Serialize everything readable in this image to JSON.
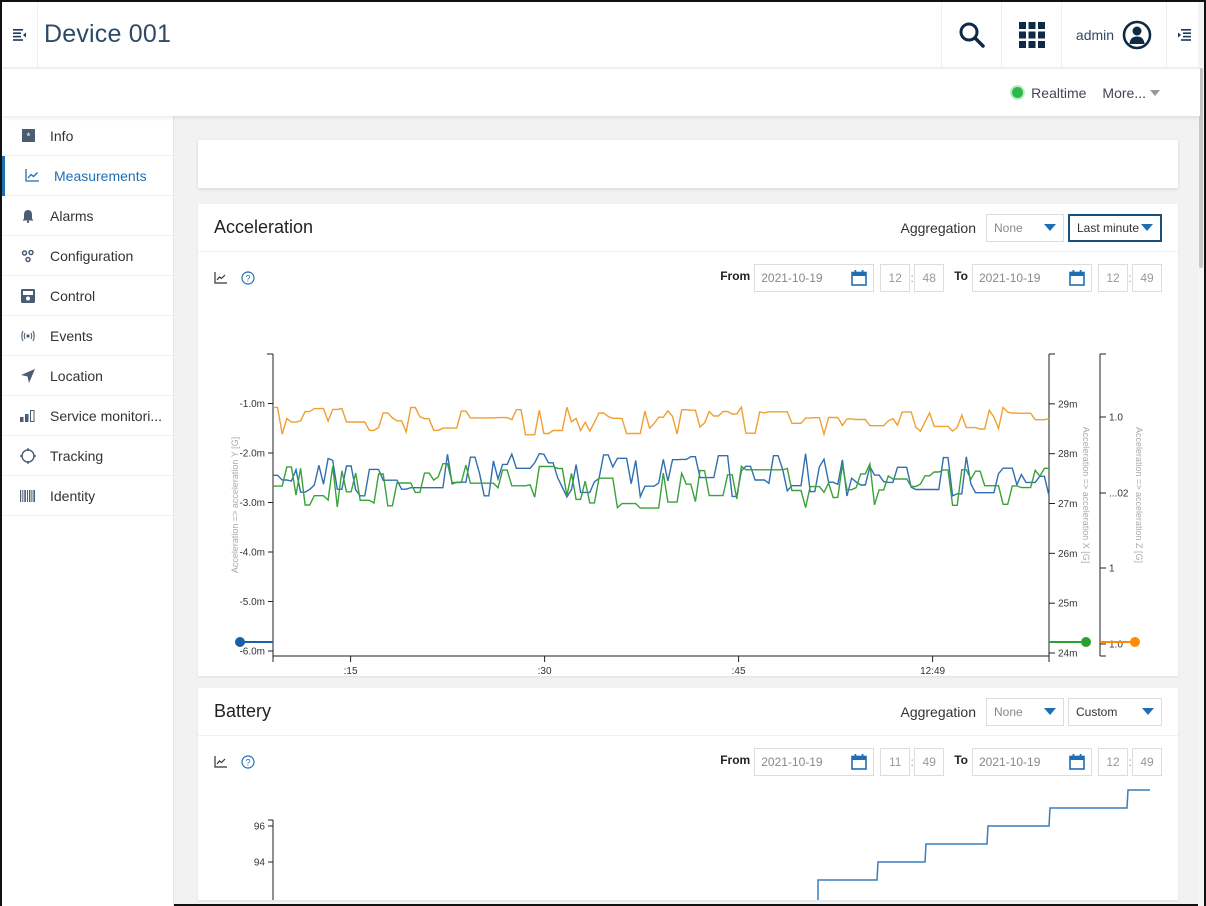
{
  "header": {
    "title": "Device 001",
    "user": "admin",
    "icons": {
      "menu_toggle": "menu-collapse-icon",
      "search": "search-icon",
      "apps": "apps-grid-icon",
      "user": "user-circle-icon",
      "right_toggle": "right-drawer-icon"
    }
  },
  "actionbar": {
    "realtime_label": "Realtime",
    "realtime_color": "#2cb94a",
    "more_label": "More..."
  },
  "sidebar": {
    "items": [
      {
        "label": "Info",
        "icon": "info-icon",
        "active": false
      },
      {
        "label": "Measurements",
        "icon": "chart-line-icon",
        "active": true
      },
      {
        "label": "Alarms",
        "icon": "bell-icon",
        "active": false
      },
      {
        "label": "Configuration",
        "icon": "gears-icon",
        "active": false
      },
      {
        "label": "Control",
        "icon": "control-icon",
        "active": false
      },
      {
        "label": "Events",
        "icon": "broadcast-icon",
        "active": false
      },
      {
        "label": "Location",
        "icon": "location-arrow-icon",
        "active": false
      },
      {
        "label": "Service monitori...",
        "icon": "signal-bars-icon",
        "active": false
      },
      {
        "label": "Tracking",
        "icon": "crosshair-icon",
        "active": false
      },
      {
        "label": "Identity",
        "icon": "barcode-icon",
        "active": false
      }
    ]
  },
  "accent_color": "#1f6eb4",
  "cards": {
    "acceleration": {
      "title": "Acceleration",
      "aggregation_label": "Aggregation",
      "aggregation_value": "None",
      "range_value": "Last minute",
      "from_label": "From",
      "from_date": "2021-10-19",
      "from_hour": "12",
      "from_minute": "48",
      "to_label": "To",
      "to_date": "2021-10-19",
      "to_hour": "12",
      "to_minute": "49"
    },
    "battery": {
      "title": "Battery",
      "aggregation_label": "Aggregation",
      "aggregation_value": "None",
      "range_value": "Custom",
      "from_label": "From",
      "from_date": "2021-10-19",
      "from_hour": "11",
      "from_minute": "49",
      "to_label": "To",
      "to_date": "2021-10-19",
      "to_hour": "12",
      "to_minute": "49"
    }
  },
  "chart_data": [
    {
      "type": "line",
      "title": "Acceleration",
      "x_ticks": [
        ":15",
        ":30",
        ":45",
        "12:49"
      ],
      "x_range_seconds": [
        9,
        69
      ],
      "x_tick_seconds": [
        15,
        30,
        45,
        60
      ],
      "axes": {
        "left": {
          "label": "Acceleration => acceleration Y [G]",
          "ticks": [
            "-1.0m",
            "-2.0m",
            "-3.0m",
            "-4.0m",
            "-5.0m",
            "-6.0m"
          ],
          "range": [
            -6.0,
            0.0
          ],
          "unit": "mG"
        },
        "right1": {
          "label": "Acceleration => acceleration X [G]",
          "ticks": [
            "29m",
            "28m",
            "27m",
            "26m",
            "25m",
            "24m"
          ],
          "range": [
            24.0,
            30.0
          ],
          "unit": "mG"
        },
        "right2": {
          "label": "Acceleration => acceleration Z [G]",
          "ticks": [
            "1.0",
            "...02",
            "1",
            "1.0"
          ]
        }
      },
      "series": [
        {
          "name": "acceleration Y",
          "axis": "left",
          "color": "#2f6fb0",
          "approx_range": [
            -3.1,
            -1.9
          ],
          "mean": -2.45
        },
        {
          "name": "acceleration X",
          "axis": "right1",
          "color": "#3aa13a",
          "approx_range": [
            26.9,
            27.9
          ],
          "mean": 27.35
        },
        {
          "name": "acceleration Z",
          "axis": "right2",
          "color": "#f0a030",
          "approx_range": "upper band",
          "mean": "~1.0"
        }
      ],
      "markers": [
        {
          "series": "acceleration Y",
          "color": "#1a5fa8"
        },
        {
          "series": "acceleration X",
          "color": "#2ca02c"
        },
        {
          "series": "acceleration Z",
          "color": "#ff8c00"
        }
      ]
    },
    {
      "type": "line",
      "title": "Battery",
      "y_ticks": [
        "96",
        "94"
      ],
      "y_range_visible": [
        92,
        98
      ],
      "series": [
        {
          "name": "battery",
          "color": "#3a7cc0",
          "steps": [
            93,
            94,
            95,
            96,
            97,
            98
          ]
        }
      ]
    }
  ]
}
